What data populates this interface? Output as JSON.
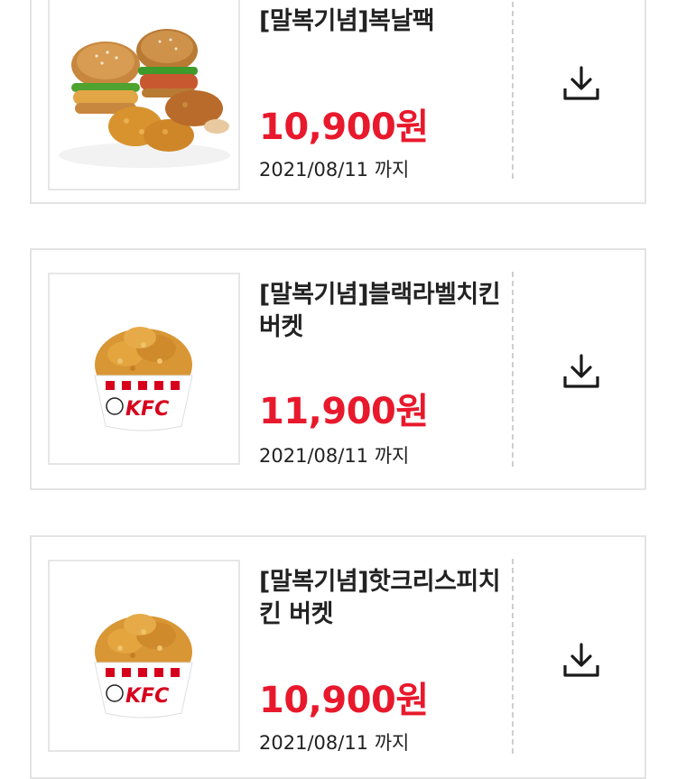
{
  "coupons": [
    {
      "title": "[말복기념]복날팩",
      "price": "10,900원",
      "expiry": "2021/08/11 까지",
      "image": "burger-and-chicken-pack",
      "download_icon": "download-icon"
    },
    {
      "title": "[말복기념]블랙라벨치킨 버켓",
      "price": "11,900원",
      "expiry": "2021/08/11 까지",
      "image": "kfc-chicken-bucket",
      "download_icon": "download-icon"
    },
    {
      "title": "[말복기념]핫크리스피치킨 버켓",
      "price": "10,900원",
      "expiry": "2021/08/11 까지",
      "image": "kfc-chicken-bucket",
      "download_icon": "download-icon"
    }
  ],
  "colors": {
    "price": "#e8192c",
    "border": "#e3e3e3",
    "divider": "#cfcfcf",
    "brand_red": "#d6001c"
  },
  "bucket_label": "KFC"
}
